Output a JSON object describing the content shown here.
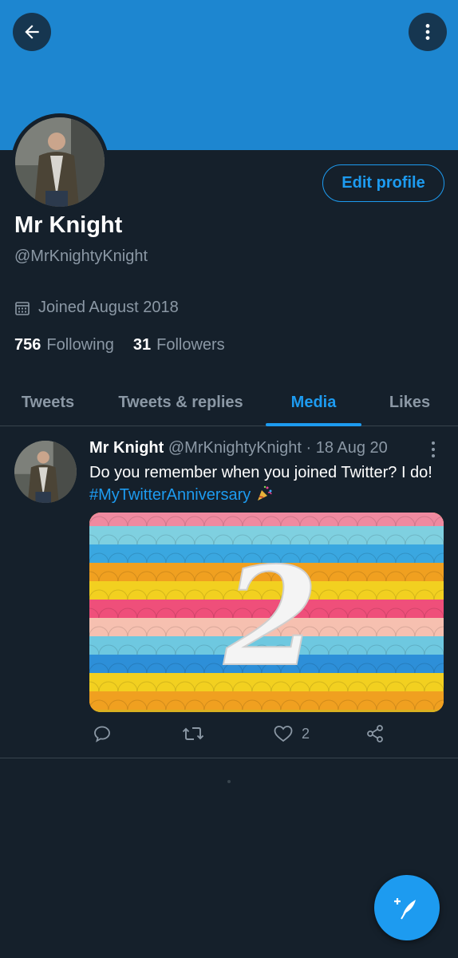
{
  "profile": {
    "name": "Mr Knight",
    "handle": "@MrKnightyKnight",
    "joined": "Joined August 2018",
    "following_count": "756",
    "following_label": "Following",
    "followers_count": "31",
    "followers_label": "Followers",
    "edit_label": "Edit profile"
  },
  "tabs": [
    {
      "label": "Tweets"
    },
    {
      "label": "Tweets & replies"
    },
    {
      "label": "Media",
      "active": true
    },
    {
      "label": "Likes"
    }
  ],
  "tweet": {
    "author_name": "Mr Knight",
    "author_meta": "@MrKnightyKnight · 18 Aug 20",
    "text": "Do you remember when you joined Twitter? I do! ",
    "hashtag": "#MyTwitterAnniversary",
    "emoji_icon": "party-popper-icon",
    "media_number": "2",
    "like_count": "2"
  },
  "colors": {
    "banner": "#1d86d0",
    "background": "#15202b",
    "accent": "#1d9bf0",
    "secondary_text": "#8b98a5"
  },
  "icons": [
    "back-arrow-icon",
    "more-vertical-icon",
    "calendar-icon",
    "reply-icon",
    "retweet-icon",
    "heart-icon",
    "share-icon",
    "compose-tweet-icon"
  ]
}
